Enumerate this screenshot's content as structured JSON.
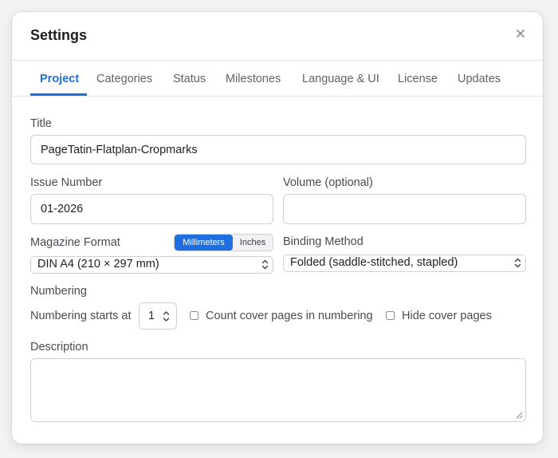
{
  "dialog": {
    "title": "Settings",
    "close_icon": "close-icon"
  },
  "tabs": [
    {
      "label": "Project",
      "active": true
    },
    {
      "label": "Categories",
      "active": false
    },
    {
      "label": "Status",
      "active": false
    },
    {
      "label": "Milestones",
      "active": false
    },
    {
      "label": "Language & UI",
      "active": false
    },
    {
      "label": "License",
      "active": false
    },
    {
      "label": "Updates",
      "active": false
    }
  ],
  "form": {
    "title_label": "Title",
    "title_value": "PageTatin-Flatplan-Cropmarks",
    "issue_label": "Issue Number",
    "issue_value": "01-2026",
    "volume_label": "Volume (optional)",
    "volume_value": "",
    "format_label": "Magazine Format",
    "units": {
      "selected": "Millimeters",
      "other": "Inches"
    },
    "format_value": "DIN A4 (210 × 297 mm)",
    "binding_label": "Binding Method",
    "binding_value": "Folded (saddle-stitched, stapled)",
    "numbering_label": "Numbering",
    "numbering_starts_label": "Numbering starts at",
    "numbering_start_value": "1",
    "count_cover_label": "Count cover pages in numbering",
    "count_cover_checked": false,
    "hide_cover_label": "Hide cover pages",
    "hide_cover_checked": false,
    "description_label": "Description",
    "description_value": ""
  },
  "colors": {
    "accent": "#1f6fe0",
    "border": "#cfd0d4",
    "text": "#2d2d30",
    "muted_text": "#5f6168"
  }
}
